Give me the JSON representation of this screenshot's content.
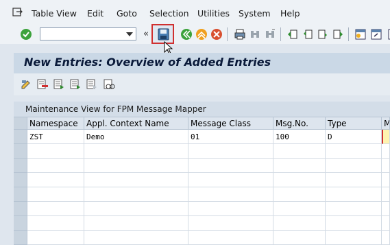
{
  "menu": {
    "items": [
      {
        "id": "table-view",
        "label": "Table View"
      },
      {
        "id": "edit",
        "label": "Edit"
      },
      {
        "id": "goto",
        "label": "Goto"
      },
      {
        "id": "selection",
        "label": "Selection"
      },
      {
        "id": "utilities",
        "label": "Utilities"
      },
      {
        "id": "system",
        "label": "System"
      },
      {
        "id": "help",
        "label": "Help"
      }
    ]
  },
  "toolbar": {
    "command_field_value": "",
    "overflow_glyph": "«"
  },
  "title": "New Entries: Overview of Added Entries",
  "table": {
    "caption": "Maintenance View for FPM Message Mapper",
    "columns": [
      "Namespace",
      "Appl. Context Name",
      "Message Class",
      "Msg.No.",
      "Type",
      "M"
    ],
    "rows": [
      [
        "ZST",
        "Demo",
        "01",
        "100",
        "D",
        ""
      ]
    ]
  },
  "colors": {
    "accent_red": "#d03030",
    "title_bar": "#cad8e6",
    "input_highlight": "#fff3b0"
  }
}
